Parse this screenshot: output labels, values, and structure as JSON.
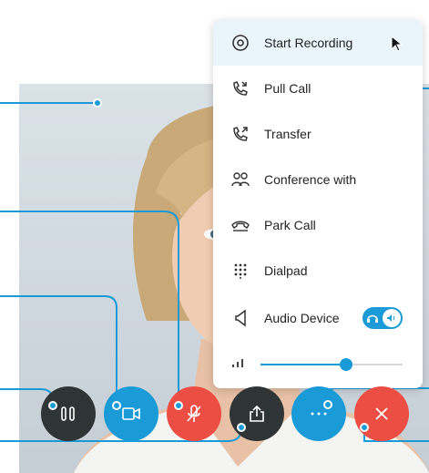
{
  "menu": {
    "items": [
      {
        "label": "Start Recording",
        "icon": "record-icon"
      },
      {
        "label": "Pull Call",
        "icon": "pull-call-icon"
      },
      {
        "label": "Transfer",
        "icon": "transfer-icon"
      },
      {
        "label": "Conference with",
        "icon": "conference-icon"
      },
      {
        "label": "Park Call",
        "icon": "park-call-icon"
      },
      {
        "label": "Dialpad",
        "icon": "dialpad-icon"
      },
      {
        "label": "Audio Device",
        "icon": "speaker-icon"
      }
    ],
    "volume": {
      "icon": "signal-bars-icon",
      "level": 0.6
    },
    "audio_toggle": {
      "on": true
    }
  },
  "controls": [
    "hold-button",
    "video-button",
    "mute-button",
    "share-button",
    "more-button",
    "end-call-button"
  ],
  "colors": {
    "accent": "#1a9ad6",
    "danger": "#ec4e44",
    "dark": "#2f3537",
    "menu_active": "#eaf4fb"
  }
}
